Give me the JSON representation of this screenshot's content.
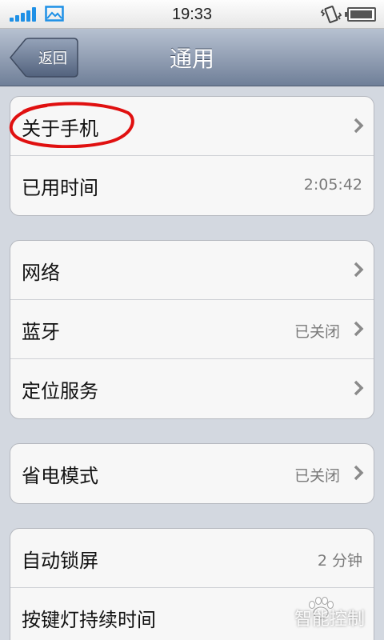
{
  "status_bar": {
    "time": "19:33",
    "battery_level": 0.95
  },
  "nav": {
    "back_label": "返回",
    "title": "通用"
  },
  "groups": [
    {
      "rows": [
        {
          "label": "关于手机",
          "value": "",
          "chevron": true
        },
        {
          "label": "已用时间",
          "value": "2:05:42",
          "chevron": false
        }
      ]
    },
    {
      "rows": [
        {
          "label": "网络",
          "value": "",
          "chevron": true
        },
        {
          "label": "蓝牙",
          "value": "已关闭",
          "chevron": true
        },
        {
          "label": "定位服务",
          "value": "",
          "chevron": true
        }
      ]
    },
    {
      "rows": [
        {
          "label": "省电模式",
          "value": "已关闭",
          "chevron": true
        }
      ]
    },
    {
      "rows": [
        {
          "label": "自动锁屏",
          "value": "2 分钟",
          "chevron": false
        },
        {
          "label": "按键灯持续时间",
          "value": "",
          "chevron": false
        }
      ]
    }
  ],
  "watermark": {
    "text": "智能控制"
  },
  "colors": {
    "annotation": "#e01010",
    "accent_blue": "#1e90e6"
  }
}
